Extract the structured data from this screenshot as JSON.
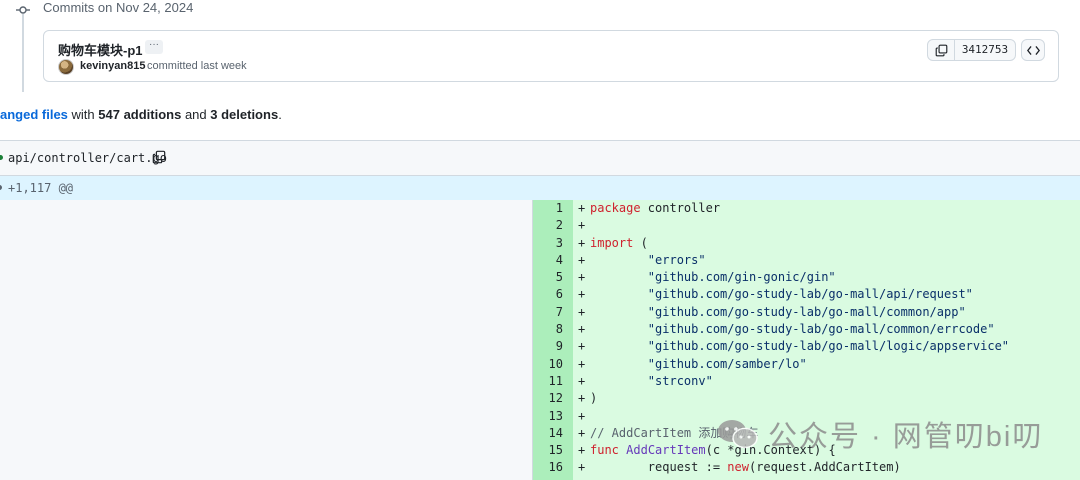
{
  "commit_group": {
    "date_label": "Commits on Nov 24, 2024"
  },
  "commit": {
    "title": "购物车模块-p1",
    "more_label": "···",
    "author": "kevinyan815",
    "meta": "committed last week",
    "sha": "3412753"
  },
  "summary": {
    "files_link": "anged files",
    "with": " with ",
    "additions": "547 additions",
    "and": " and ",
    "deletions": "3 deletions",
    "end": "."
  },
  "file": {
    "path": "api/controller/cart.go",
    "hunk": "+1,117 @@"
  },
  "diff_lines": [
    {
      "n": "1",
      "segments": [
        [
          "kw",
          "package"
        ],
        [
          "",
          "controller"
        ]
      ]
    },
    {
      "n": "2",
      "segments": []
    },
    {
      "n": "3",
      "segments": [
        [
          "kw",
          "import"
        ],
        [
          "",
          " ("
        ]
      ]
    },
    {
      "n": "4",
      "segments": [
        [
          "str",
          "        \"errors\""
        ]
      ]
    },
    {
      "n": "5",
      "segments": [
        [
          "str",
          "        \"github.com/gin-gonic/gin\""
        ]
      ]
    },
    {
      "n": "6",
      "segments": [
        [
          "str",
          "        \"github.com/go-study-lab/go-mall/api/request\""
        ]
      ]
    },
    {
      "n": "7",
      "segments": [
        [
          "str",
          "        \"github.com/go-study-lab/go-mall/common/app\""
        ]
      ]
    },
    {
      "n": "8",
      "segments": [
        [
          "str",
          "        \"github.com/go-study-lab/go-mall/common/errcode\""
        ]
      ]
    },
    {
      "n": "9",
      "segments": [
        [
          "str",
          "        \"github.com/go-study-lab/go-mall/logic/appservice\""
        ]
      ]
    },
    {
      "n": "10",
      "segments": [
        [
          "str",
          "        \"github.com/samber/lo\""
        ]
      ]
    },
    {
      "n": "11",
      "segments": [
        [
          "str",
          "        \"strconv\""
        ]
      ]
    },
    {
      "n": "12",
      "segments": [
        [
          "",
          ")"
        ]
      ]
    },
    {
      "n": "13",
      "segments": []
    },
    {
      "n": "14",
      "segments": [
        [
          "cm",
          "// AddCartItem 添加购物车"
        ]
      ]
    },
    {
      "n": "15",
      "segments": [
        [
          "kw",
          "func"
        ],
        [
          "",
          " "
        ],
        [
          "fn",
          "AddCartItem"
        ],
        [
          "",
          "(c *gin.Context) {"
        ]
      ]
    },
    {
      "n": "16",
      "segments": [
        [
          "",
          "        request := "
        ],
        [
          "kw",
          "new"
        ],
        [
          "",
          "(request.AddCartItem)"
        ]
      ]
    }
  ],
  "watermark": "公众号 · 网管叨bi叨",
  "icons": {
    "commit": "git-commit-icon",
    "copy": "copy-icon",
    "code": "code-icon",
    "wechat": "wechat-logo-icon"
  }
}
